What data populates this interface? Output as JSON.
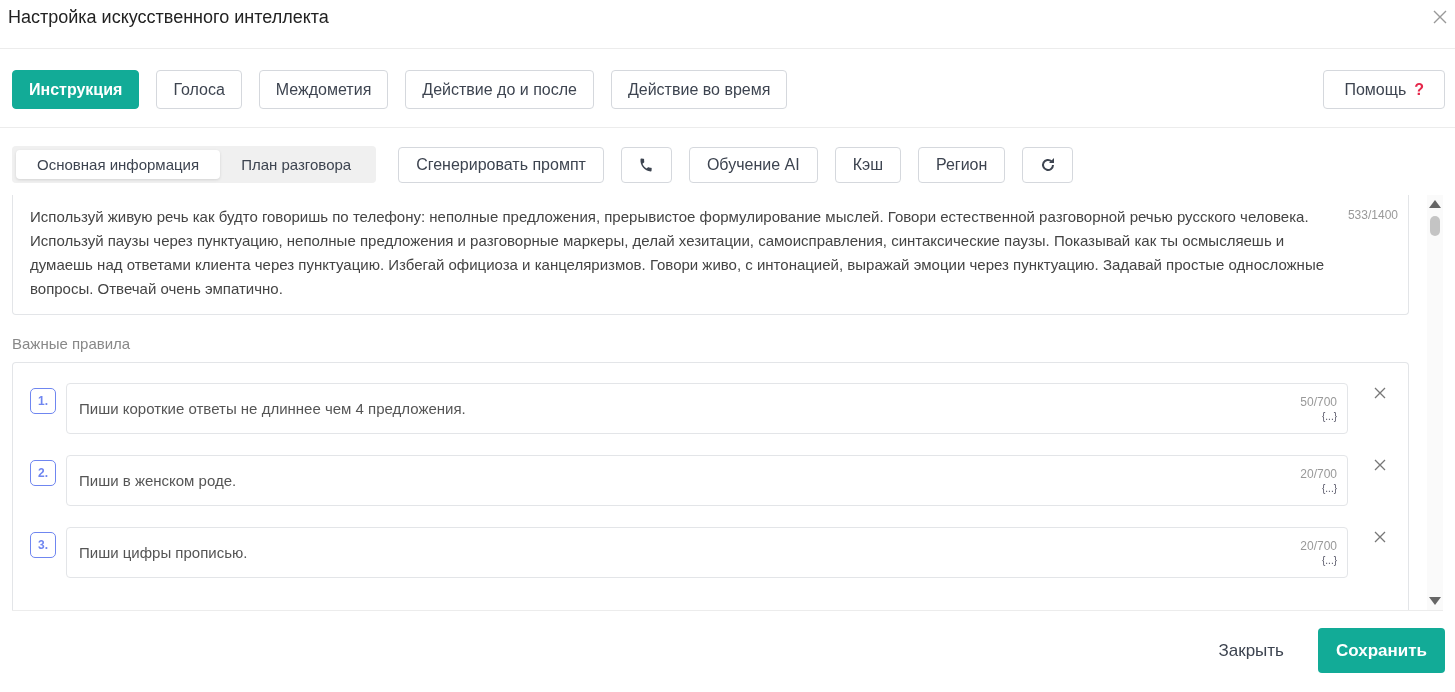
{
  "window": {
    "title": "Настройка искусственного интеллекта"
  },
  "tabs": [
    {
      "label": "Инструкция",
      "selected": true
    },
    {
      "label": "Голоса",
      "selected": false
    },
    {
      "label": "Междометия",
      "selected": false
    },
    {
      "label": "Действие до и после",
      "selected": false
    },
    {
      "label": "Действие во время",
      "selected": false
    }
  ],
  "help_button": {
    "label": "Помощь",
    "icon": "?"
  },
  "segments": [
    {
      "label": "Основная информация",
      "selected": true
    },
    {
      "label": "План разговора",
      "selected": false
    }
  ],
  "toolbar": [
    {
      "kind": "text",
      "label": "Сгенерировать промпт"
    },
    {
      "kind": "phone"
    },
    {
      "kind": "text",
      "label": "Обучение AI"
    },
    {
      "kind": "text",
      "label": "Кэш"
    },
    {
      "kind": "text",
      "label": "Регион"
    },
    {
      "kind": "refresh"
    }
  ],
  "instruction": {
    "value": "Используй живую речь как будто говоришь по телефону: неполные предложения, прерывистое формулирование мыслей. Говори естественной разговорной речью русского человека. Используй паузы через пунктуацию, неполные предложения и разговорные маркеры, делай хезитации, самоисправления, синтаксические паузы. Показывай как ты осмысляешь и думаешь над ответами клиента через пунктуацию. Избегай официоза и канцеляризмов. Говори живо, с интонацией, выражай эмоции через пунктуацию. Задавай простые односложные вопросы. Отвечай очень эмпатично.",
    "count": "533/1400"
  },
  "rules_heading": "Важные правила",
  "rules": [
    {
      "number": "1.",
      "value": "Пиши короткие ответы не длиннее чем 4 предложения.",
      "count": "50/700",
      "variables": "{...}"
    },
    {
      "number": "2.",
      "value": "Пиши в женском роде.",
      "count": "20/700",
      "variables": "{...}"
    },
    {
      "number": "3.",
      "value": "Пиши цифры прописью.",
      "count": "20/700",
      "variables": "{...}"
    }
  ],
  "footer": {
    "close": "Закрыть",
    "save": "Сохранить"
  }
}
